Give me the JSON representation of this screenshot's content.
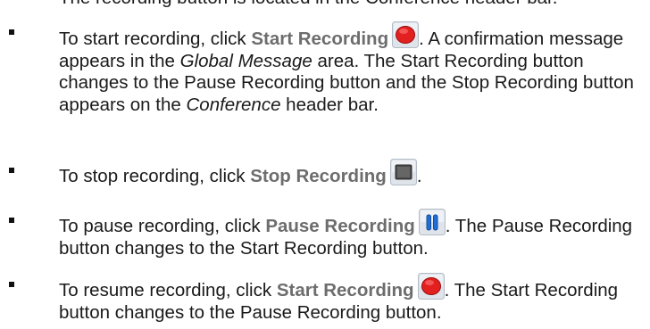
{
  "intro_fragment": "The recording button is located in the Conference header bar.",
  "bullets": [
    {
      "pre": "To start recording, click ",
      "command": "Start Recording",
      "icon": "record-icon",
      "post_a": ". A confirmation message appears in the ",
      "italic_a": "Global Message",
      "post_b": " area. The Start Recording button changes to the Pause Recording button and the Stop Recording button appears on the ",
      "italic_b": "Conference",
      "post_c": " header bar."
    },
    {
      "pre": "To stop recording, click ",
      "command": "Stop Recording",
      "icon": "stop-icon",
      "post_a": "."
    },
    {
      "pre": "To pause recording, click ",
      "command": "Pause Recording",
      "icon": "pause-icon",
      "post_a": ". The Pause Recording button changes to the Start Recording button."
    },
    {
      "pre": "To resume recording, click ",
      "command": "Start Recording",
      "icon": "record-icon",
      "post_a": ". The Start Recording button changes to the Pause Recording button."
    }
  ],
  "colors": {
    "text": "#1a1a1a",
    "command": "#6d6d6d",
    "record": "#e32020",
    "pause": "#1f6fd6",
    "stop": "#4a4a4a",
    "icon_frame": "#d7dde5"
  }
}
